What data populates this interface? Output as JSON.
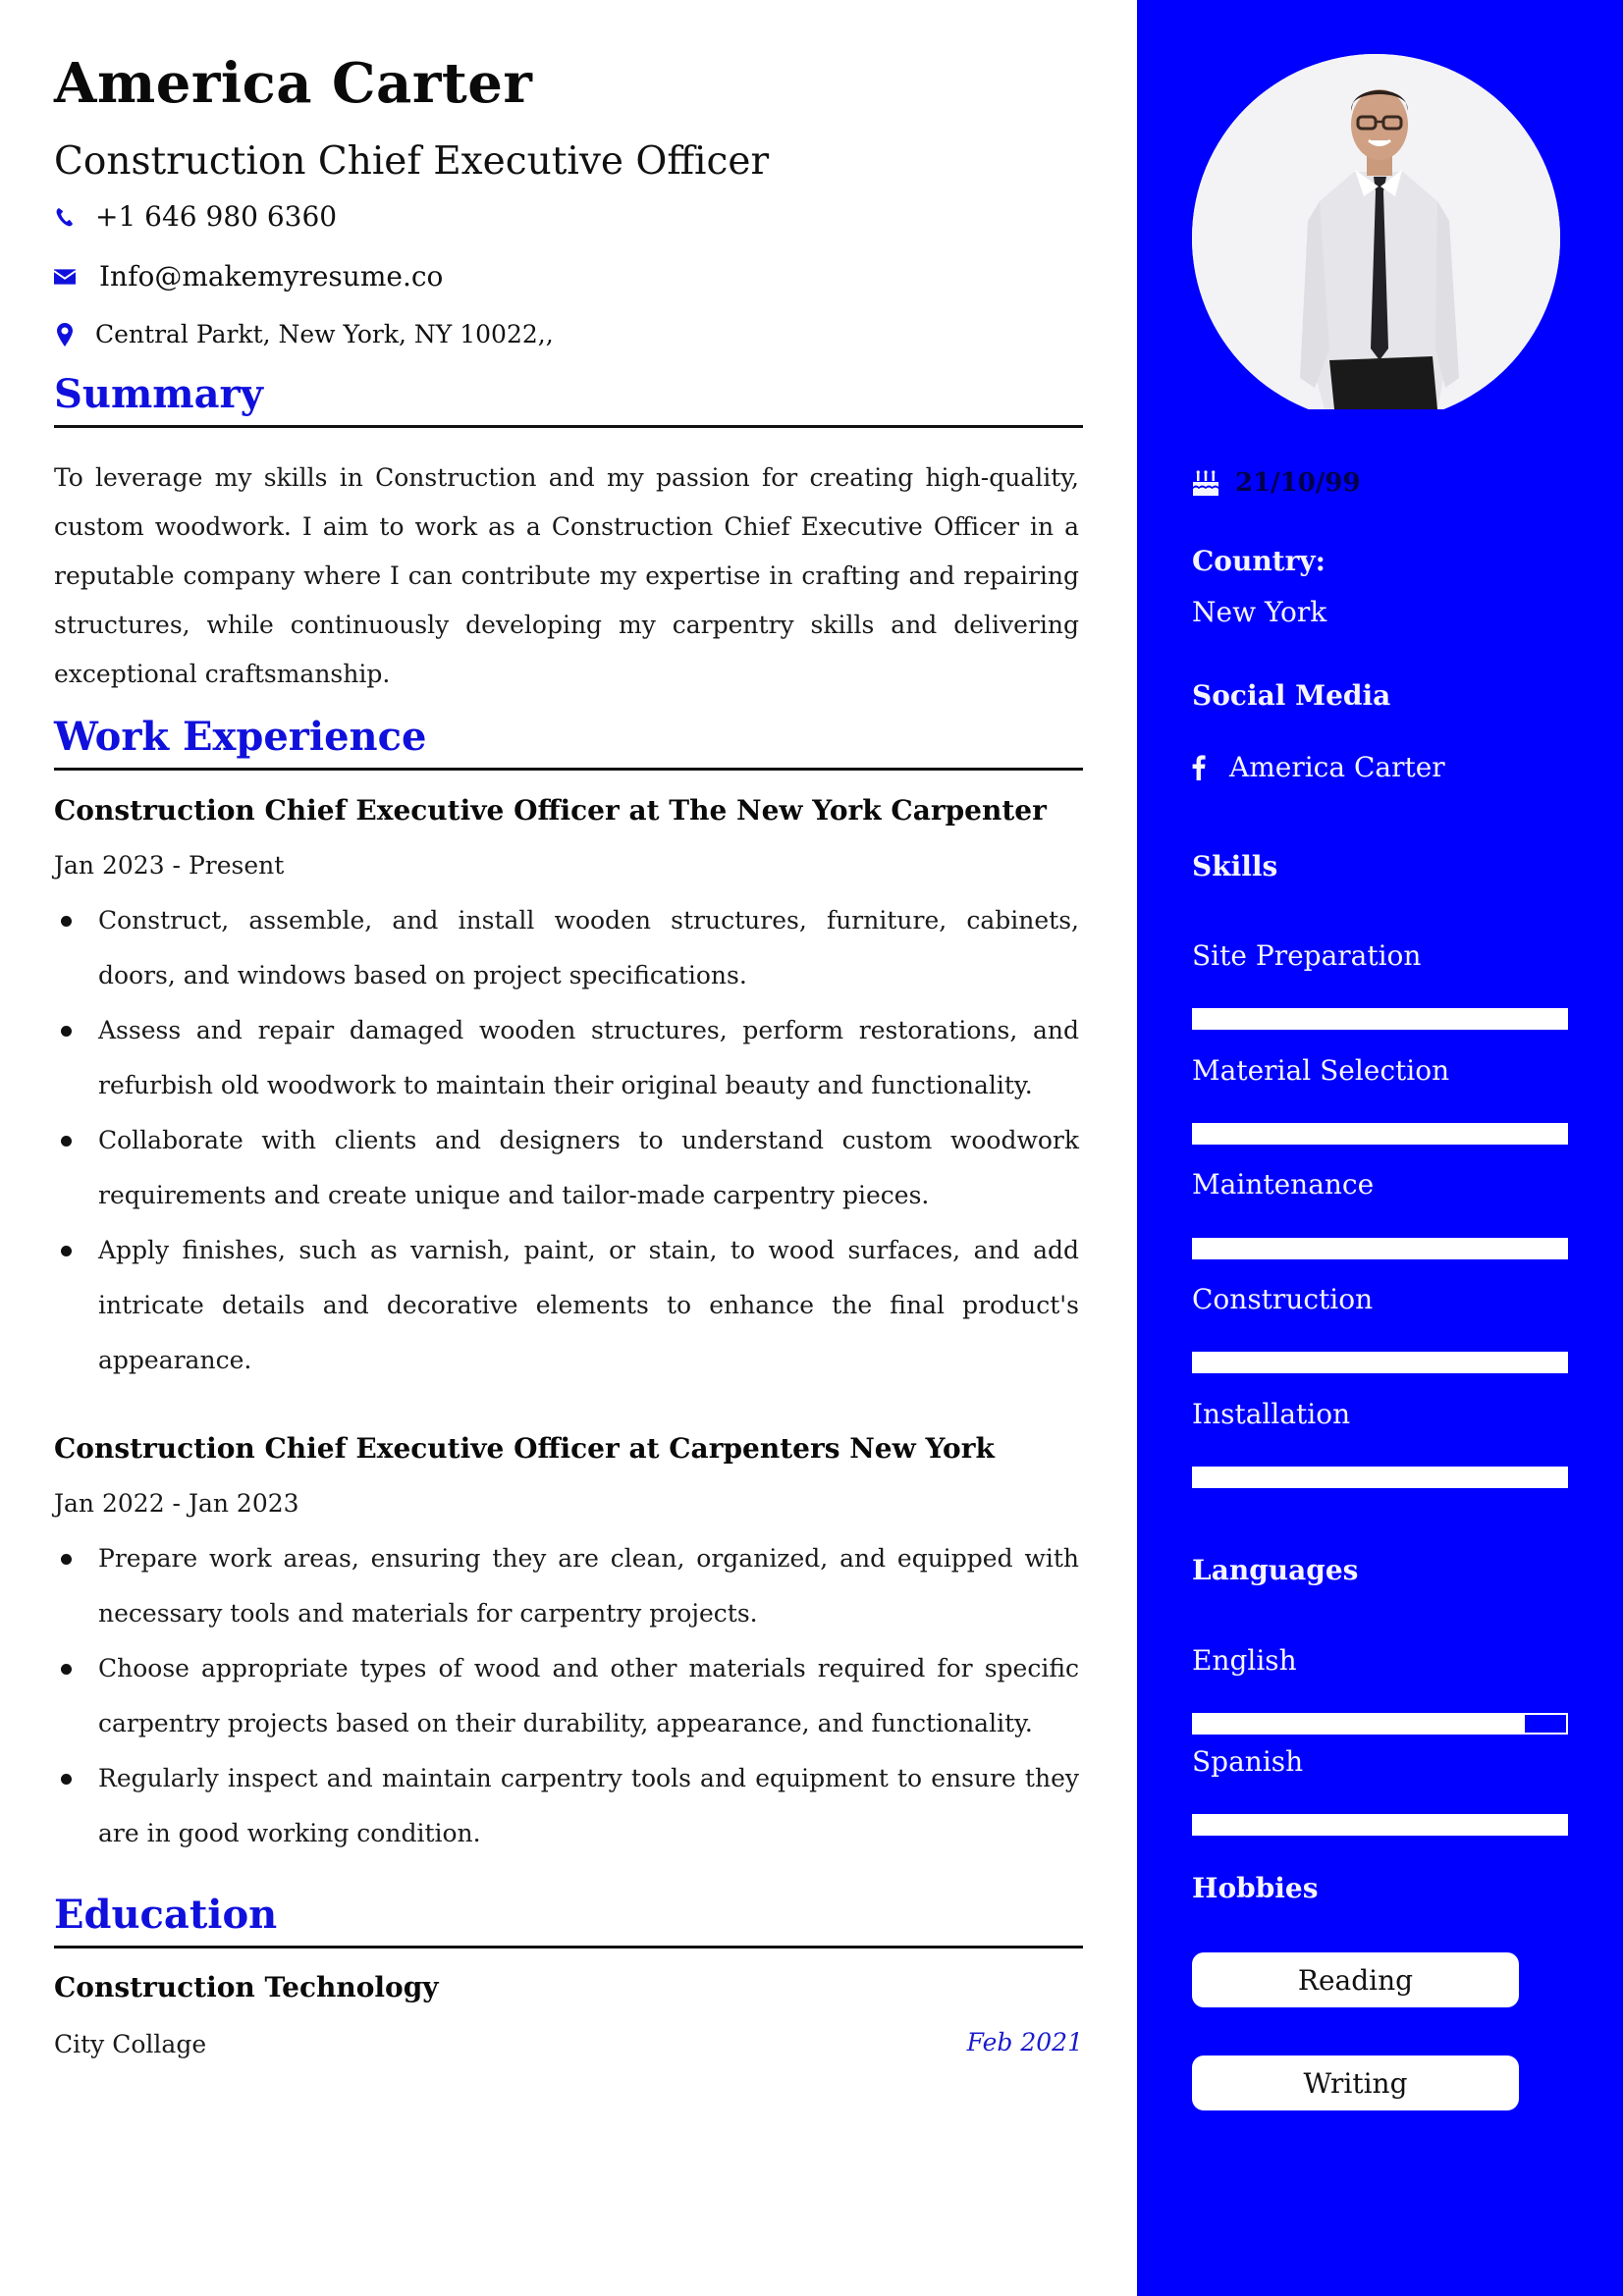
{
  "header": {
    "name": "America Carter",
    "title": "Construction Chief Executive Officer",
    "contacts": {
      "phone": {
        "icon": "phone-icon",
        "value": "+1 646 980 6360"
      },
      "email": {
        "icon": "envelope-icon",
        "value": "Info@makemyresume.co"
      },
      "address": {
        "icon": "map-marker-icon",
        "value": "Central Parkt, New York, NY 10022,,"
      }
    }
  },
  "colors": {
    "accent": "#0000ff",
    "heading": "#1010dd",
    "sidebar_text": "#f5f5ff"
  },
  "sections": {
    "summary": "Summary",
    "work": "Work Experience",
    "education": "Education"
  },
  "summary": "To leverage my skills in Construction and my passion for creating high-quality, custom woodwork. I aim to work as a Construction Chief Executive Officer in a reputable company where I can contribute my expertise in crafting and repairing structures, while continuously developing my carpentry skills and delivering exceptional craftsmanship.",
  "work": [
    {
      "title": "Construction Chief Executive Officer at The New York Carpenter",
      "dates": "Jan 2023 - Present",
      "bullets": [
        "Construct, assemble, and install wooden structures, furniture, cabinets, doors, and windows based on project specifications.",
        "Assess and repair damaged wooden structures, perform restorations, and refurbish old woodwork to maintain their original beauty and functionality.",
        "Collaborate with clients and designers to understand custom woodwork requirements and create unique and tailor-made carpentry pieces.",
        "Apply finishes, such as varnish, paint, or stain, to wood surfaces, and add intricate details and decorative elements to enhance the final product's appearance."
      ]
    },
    {
      "title": "Construction Chief Executive Officer at Carpenters New York",
      "dates": "Jan 2022 - Jan 2023",
      "bullets": [
        "Prepare work areas, ensuring they are clean, organized, and equipped with necessary tools and materials for carpentry projects.",
        "Choose appropriate types of wood and other materials required for specific carpentry projects based on their durability, appearance, and functionality.",
        "Regularly inspect and maintain carpentry tools and equipment to ensure they are in good working condition."
      ]
    }
  ],
  "education": {
    "degree": "Construction Technology",
    "school": "City Collage",
    "date": "Feb 2021"
  },
  "sidebar": {
    "photo_alt": "Profile photo of man in white shirt and black tie",
    "dob": {
      "icon": "birthday-cake-icon",
      "value": "21/10/99"
    },
    "country_label": "Country:",
    "country_value": "New York",
    "social_label": "Social Media",
    "social": {
      "icon": "facebook-icon",
      "value": "America Carter"
    },
    "skills_label": "Skills",
    "skills": [
      {
        "name": "Site Preparation",
        "level_pct": 100
      },
      {
        "name": "Material Selection",
        "level_pct": 100
      },
      {
        "name": "Maintenance",
        "level_pct": 100
      },
      {
        "name": "Construction",
        "level_pct": 100
      },
      {
        "name": "Installation",
        "level_pct": 100
      }
    ],
    "languages_label": "Languages",
    "languages": [
      {
        "name": "English",
        "level_pct": 89
      },
      {
        "name": "Spanish",
        "level_pct": 100
      }
    ],
    "hobbies_label": "Hobbies",
    "hobbies": [
      "Reading",
      "Writing"
    ]
  }
}
